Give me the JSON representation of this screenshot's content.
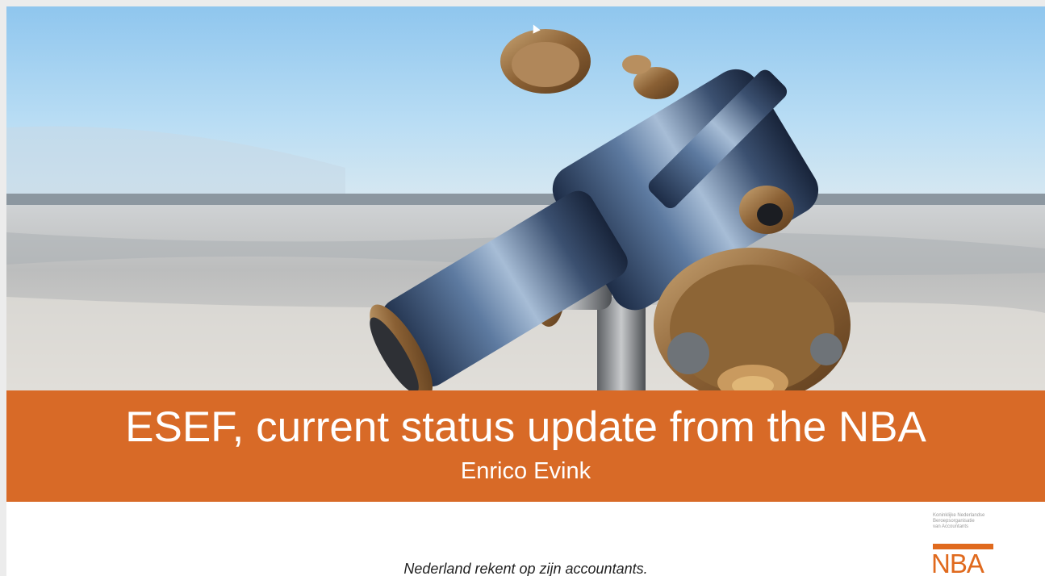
{
  "slide": {
    "title": "ESEF, current status update from the NBA",
    "subtitle": "Enrico Evink",
    "tagline": "Nederland rekent op zijn accountants.",
    "image": {
      "subject": "telescope-by-the-sea"
    }
  },
  "logo": {
    "fine_print": "Koninklijke Nederlandse\nBeroepsorganisatie\nvan Accountants",
    "mark": "NBA"
  },
  "colors": {
    "accent": "#d6621b",
    "logo": "#e06a1e",
    "sky": "#a9d3f1",
    "sand": "#d9d6d1"
  }
}
